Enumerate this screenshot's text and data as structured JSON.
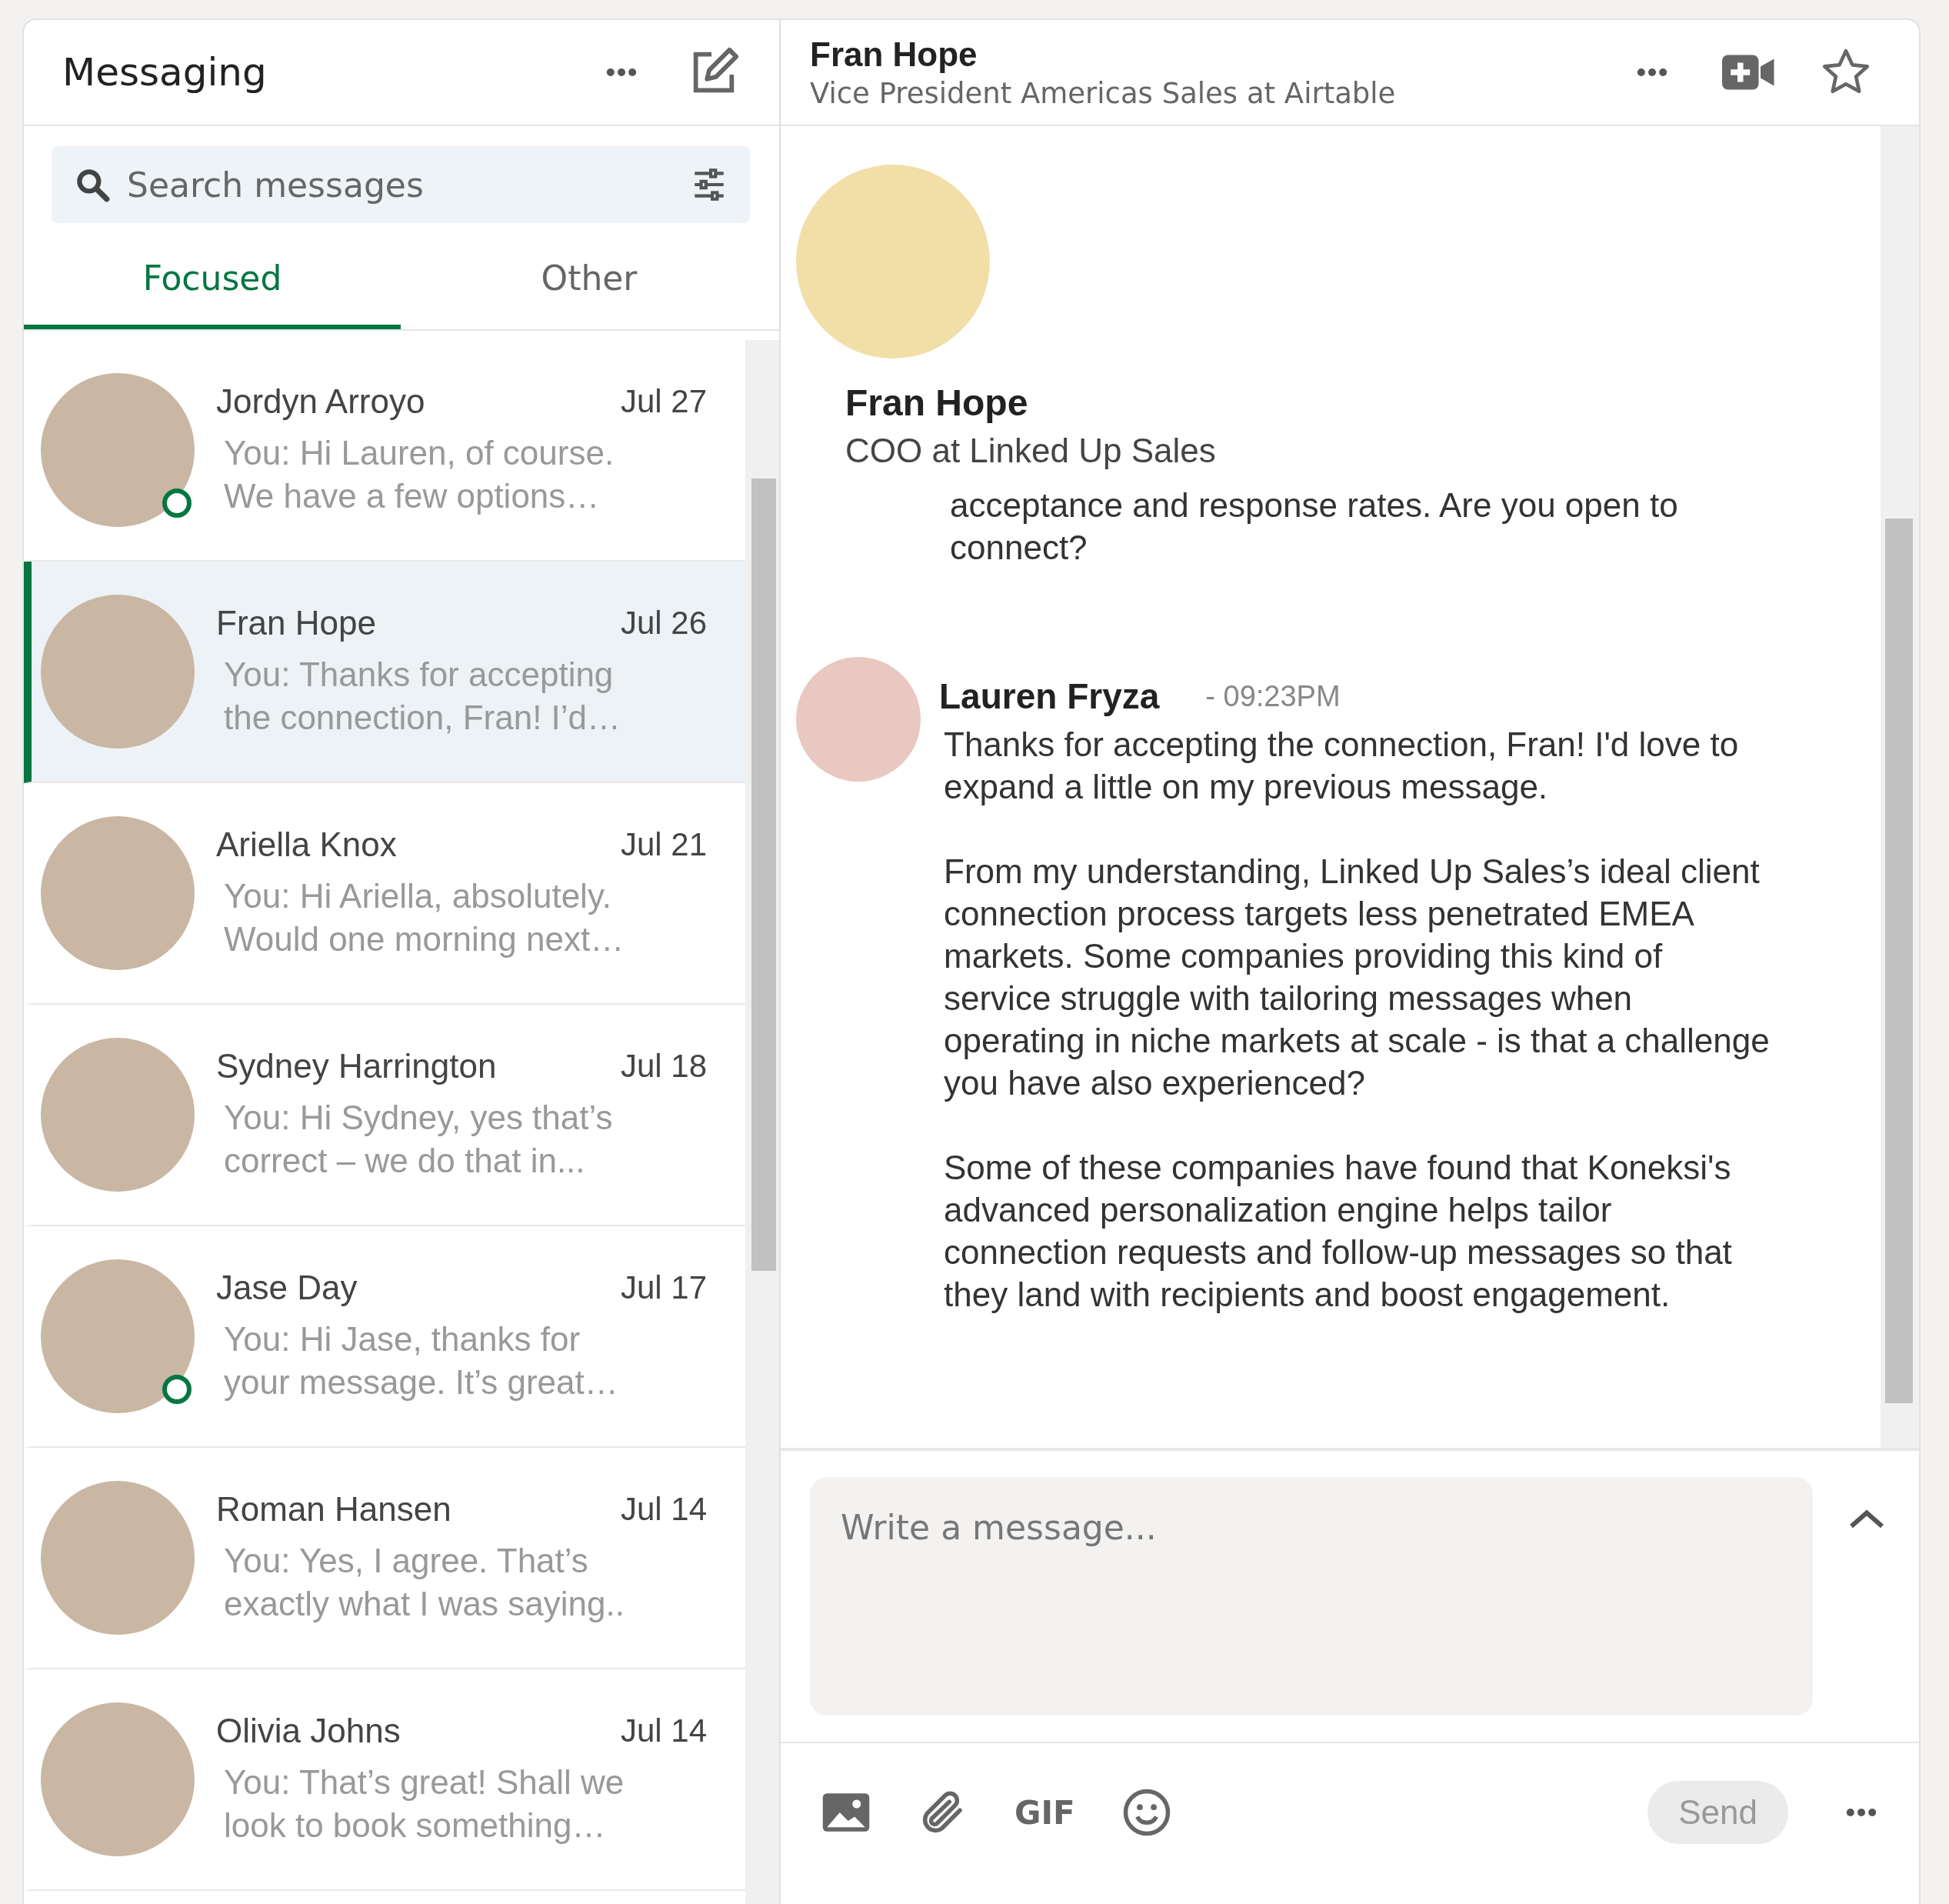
{
  "sidebar": {
    "title": "Messaging",
    "search": {
      "placeholder": "Search messages"
    },
    "tabs": [
      {
        "label": "Focused",
        "selected": true
      },
      {
        "label": "Other",
        "selected": false
      }
    ],
    "conversations": [
      {
        "name": "Jordyn Arroyo",
        "date": "Jul 27",
        "preview": "You: Hi Lauren, of course. We have a few options…",
        "selected": false,
        "online": true
      },
      {
        "name": "Fran Hope",
        "date": "Jul 26",
        "preview": "You: Thanks for accepting the connection, Fran! I’d…",
        "selected": true,
        "online": false
      },
      {
        "name": "Ariella Knox",
        "date": "Jul 21",
        "preview": "You: Hi Ariella, absolutely. Would one morning next…",
        "selected": false,
        "online": false
      },
      {
        "name": "Sydney Harrington",
        "date": "Jul 18",
        "preview": "You: Hi Sydney, yes that’s correct – we do that in...",
        "selected": false,
        "online": false
      },
      {
        "name": "Jase Day",
        "date": "Jul 17",
        "preview": "You: Hi Jase, thanks for your message. It’s great…",
        "selected": false,
        "online": true
      },
      {
        "name": "Roman Hansen",
        "date": "Jul 14",
        "preview": "You: Yes, I agree. That’s exactly what I was saying..",
        "selected": false,
        "online": false
      },
      {
        "name": "Olivia Johns",
        "date": "Jul 14",
        "preview": "You: That’s great! Shall we look to book something…",
        "selected": false,
        "online": false
      }
    ]
  },
  "conversation": {
    "header": {
      "name": "Fran Hope",
      "subtitle": "Vice President Americas Sales at Airtable"
    },
    "profile": {
      "name": "Fran Hope",
      "headline": "COO at Linked Up Sales"
    },
    "messages": [
      {
        "paragraphs": [
          "acceptance and response rates. Are you open to connect?"
        ]
      },
      {
        "sender": "Lauren Fryza",
        "time": "- 09:23PM",
        "paragraphs": [
          "Thanks for accepting the connection, Fran! I'd love to expand a little on my previous message.",
          "From my understanding, Linked Up Sales’s ideal client connection process targets less penetrated EMEA markets. Some companies providing this kind of service struggle with tailoring messages when operating in niche markets at scale - is that a challenge you have also experienced?",
          "Some of these companies have found that Koneksi's advanced personalization engine helps tailor connection requests and follow-up messages so that they land with recipients and boost engagement."
        ]
      }
    ],
    "composer": {
      "placeholder": "Write a message...",
      "gif": "GIF",
      "send": "Send"
    }
  }
}
